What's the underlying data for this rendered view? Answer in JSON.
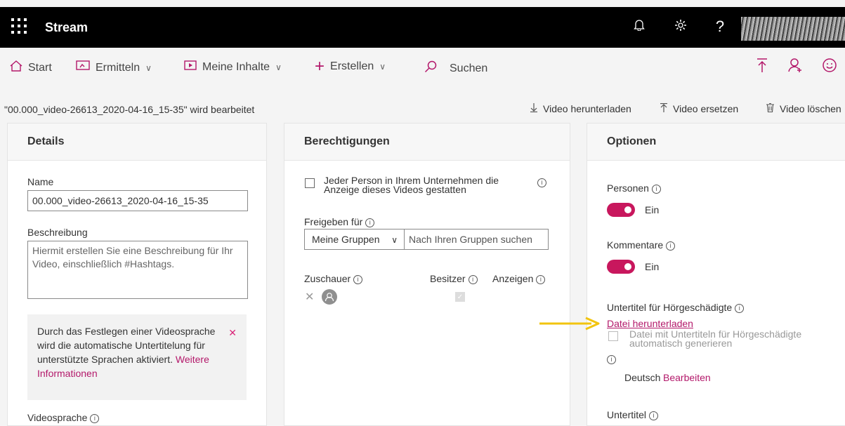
{
  "app": {
    "title": "Stream"
  },
  "nav": {
    "start": "Start",
    "discover": "Ermitteln",
    "my_content": "Meine Inhalte",
    "create": "Erstellen",
    "search": "Suchen"
  },
  "page": {
    "editing_title": "\"00.000_video-26613_2020-04-16_15-35\" wird bearbeitet",
    "actions": {
      "download": "Video herunterladen",
      "replace": "Video ersetzen",
      "delete": "Video löschen"
    }
  },
  "details": {
    "heading": "Details",
    "name_label": "Name",
    "name_value": "00.000_video-26613_2020-04-16_15-35",
    "description_label": "Beschreibung",
    "description_placeholder": "Hiermit erstellen Sie eine Beschreibung für Ihr Video, einschließlich #Hashtags.",
    "notice_text": "Durch das Festlegen einer Videosprache wird die automatische Untertitelung für unterstützte Sprachen aktiviert.",
    "notice_link": "Weitere Informationen",
    "video_language_label": "Videosprache"
  },
  "permissions": {
    "heading": "Berechtigungen",
    "allow_everyone": "Jeder Person in Ihrem Unternehmen die Anzeige dieses Videos gestatten",
    "share_with_label": "Freigeben für",
    "share_with_value": "Meine Gruppen",
    "group_search_placeholder": "Nach Ihren Gruppen suchen",
    "viewers_col": "Zuschauer",
    "owner_col": "Besitzer",
    "display_col": "Anzeigen"
  },
  "options": {
    "heading": "Optionen",
    "people_label": "Personen",
    "people_value": "Ein",
    "comments_label": "Kommentare",
    "comments_value": "Ein",
    "captions_label": "Untertitel für Hörgeschädigte",
    "download_file": "Datei herunterladen",
    "autogen_label": "Datei mit Untertiteln für Hörgeschädigte automatisch generieren",
    "language": "Deutsch",
    "edit": "Bearbeiten",
    "subtitles_label": "Untertitel"
  },
  "colors": {
    "accent": "#b3186a",
    "toggle_on": "#c8175d",
    "arrow": "#f2c40f",
    "topbar": "#000000"
  }
}
